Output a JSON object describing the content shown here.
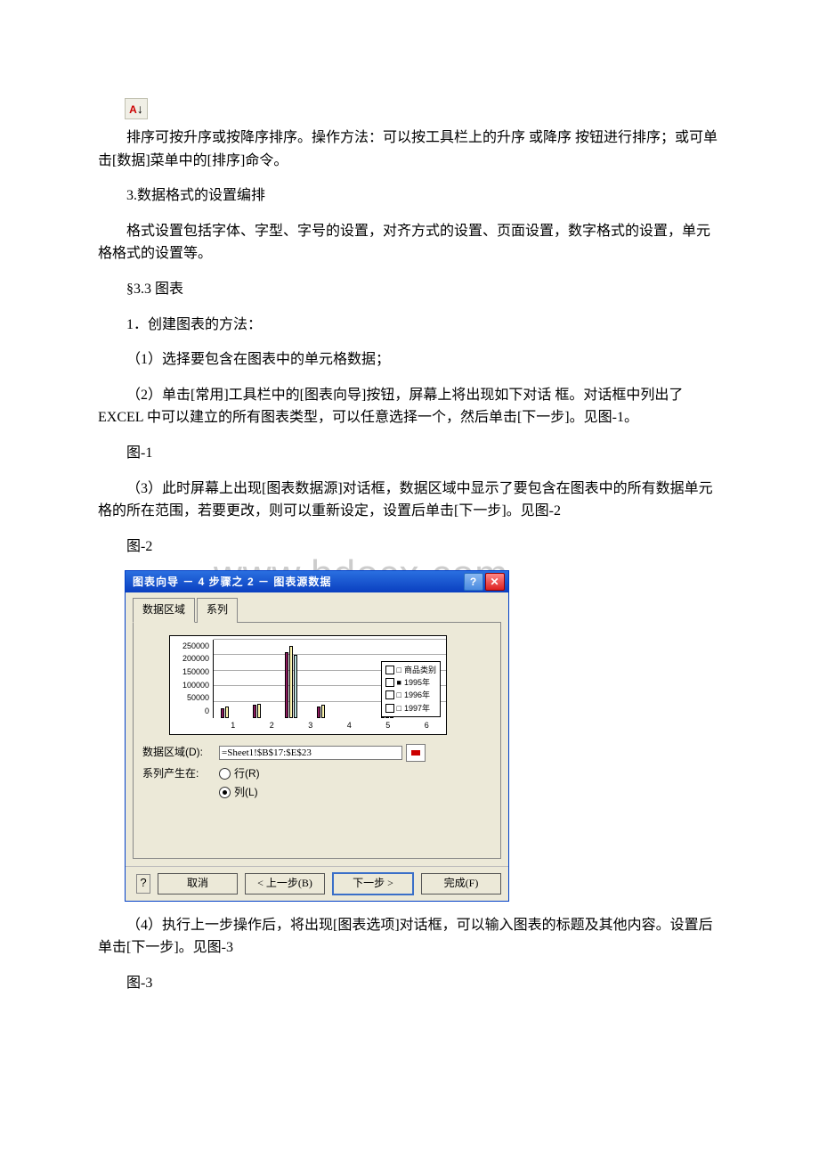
{
  "icons": {
    "sort_asc_name": "sort-ascending-icon"
  },
  "body": {
    "p1": "排序可按升序或按降序排序。操作方法：可以按工具栏上的升序 或降序 按钮进行排序；或可单击[数据]菜单中的[排序]命令。",
    "p2": "3.数据格式的设置编排",
    "p3": "格式设置包括字体、字型、字号的设置，对齐方式的设置、页面设置，数字格式的设置，单元格格式的设置等。",
    "p4": "§3.3 图表",
    "p5": "1．创建图表的方法：",
    "p6": "（1）选择要包含在图表中的单元格数据；",
    "p7": "（2）单击[常用]工具栏中的[图表向导]按钮，屏幕上将出现如下对话 框。对话框中列出了 EXCEL 中可以建立的所有图表类型，可以任意选择一个，然后单击[下一步]。见图-1。",
    "p8": "图-1",
    "p9": "（3）此时屏幕上出现[图表数据源]对话框，数据区域中显示了要包含在图表中的所有数据单元格的所在范围，若要更改，则可以重新设定，设置后单击[下一步]。见图-2",
    "p10": "图-2",
    "p11": "（4）执行上一步操作后，将出现[图表选项]对话框，可以输入图表的标题及其他内容。设置后单击[下一步]。见图-3",
    "p12": "图-3"
  },
  "watermark": "www.bdocx.com",
  "dialog": {
    "title": "图表向导 － 4 步骤之 2 － 图表源数据",
    "tabs": {
      "active": "数据区域",
      "other": "系列"
    },
    "form": {
      "range_label": "数据区域(D):",
      "range_value": "=Sheet1!$B$17:$E$23",
      "series_in_label": "系列产生在:",
      "row_label": "行(R)",
      "col_label": "列(L)",
      "series_in_value": "col"
    },
    "legend": [
      "商品类别",
      "1995年",
      "1996年",
      "1997年"
    ],
    "buttons": {
      "cancel": "取消",
      "back": "< 上一步(B)",
      "next": "下一步 >",
      "finish": "完成(F)"
    }
  },
  "chart_data": {
    "type": "bar",
    "categories": [
      "1",
      "2",
      "3",
      "4",
      "5",
      "6"
    ],
    "series": [
      {
        "name": "商品类别",
        "values": [
          0,
          0,
          0,
          0,
          0,
          0
        ]
      },
      {
        "name": "1995年",
        "values": [
          30000,
          40000,
          210000,
          35000,
          0,
          30000
        ]
      },
      {
        "name": "1996年",
        "values": [
          35000,
          45000,
          230000,
          40000,
          0,
          35000
        ]
      },
      {
        "name": "1997年",
        "values": [
          0,
          0,
          200000,
          0,
          0,
          40000
        ]
      }
    ],
    "ylim": [
      0,
      250000
    ],
    "yticks": [
      0,
      50000,
      100000,
      150000,
      200000,
      250000
    ],
    "xlabel": "",
    "ylabel": "",
    "title": ""
  }
}
